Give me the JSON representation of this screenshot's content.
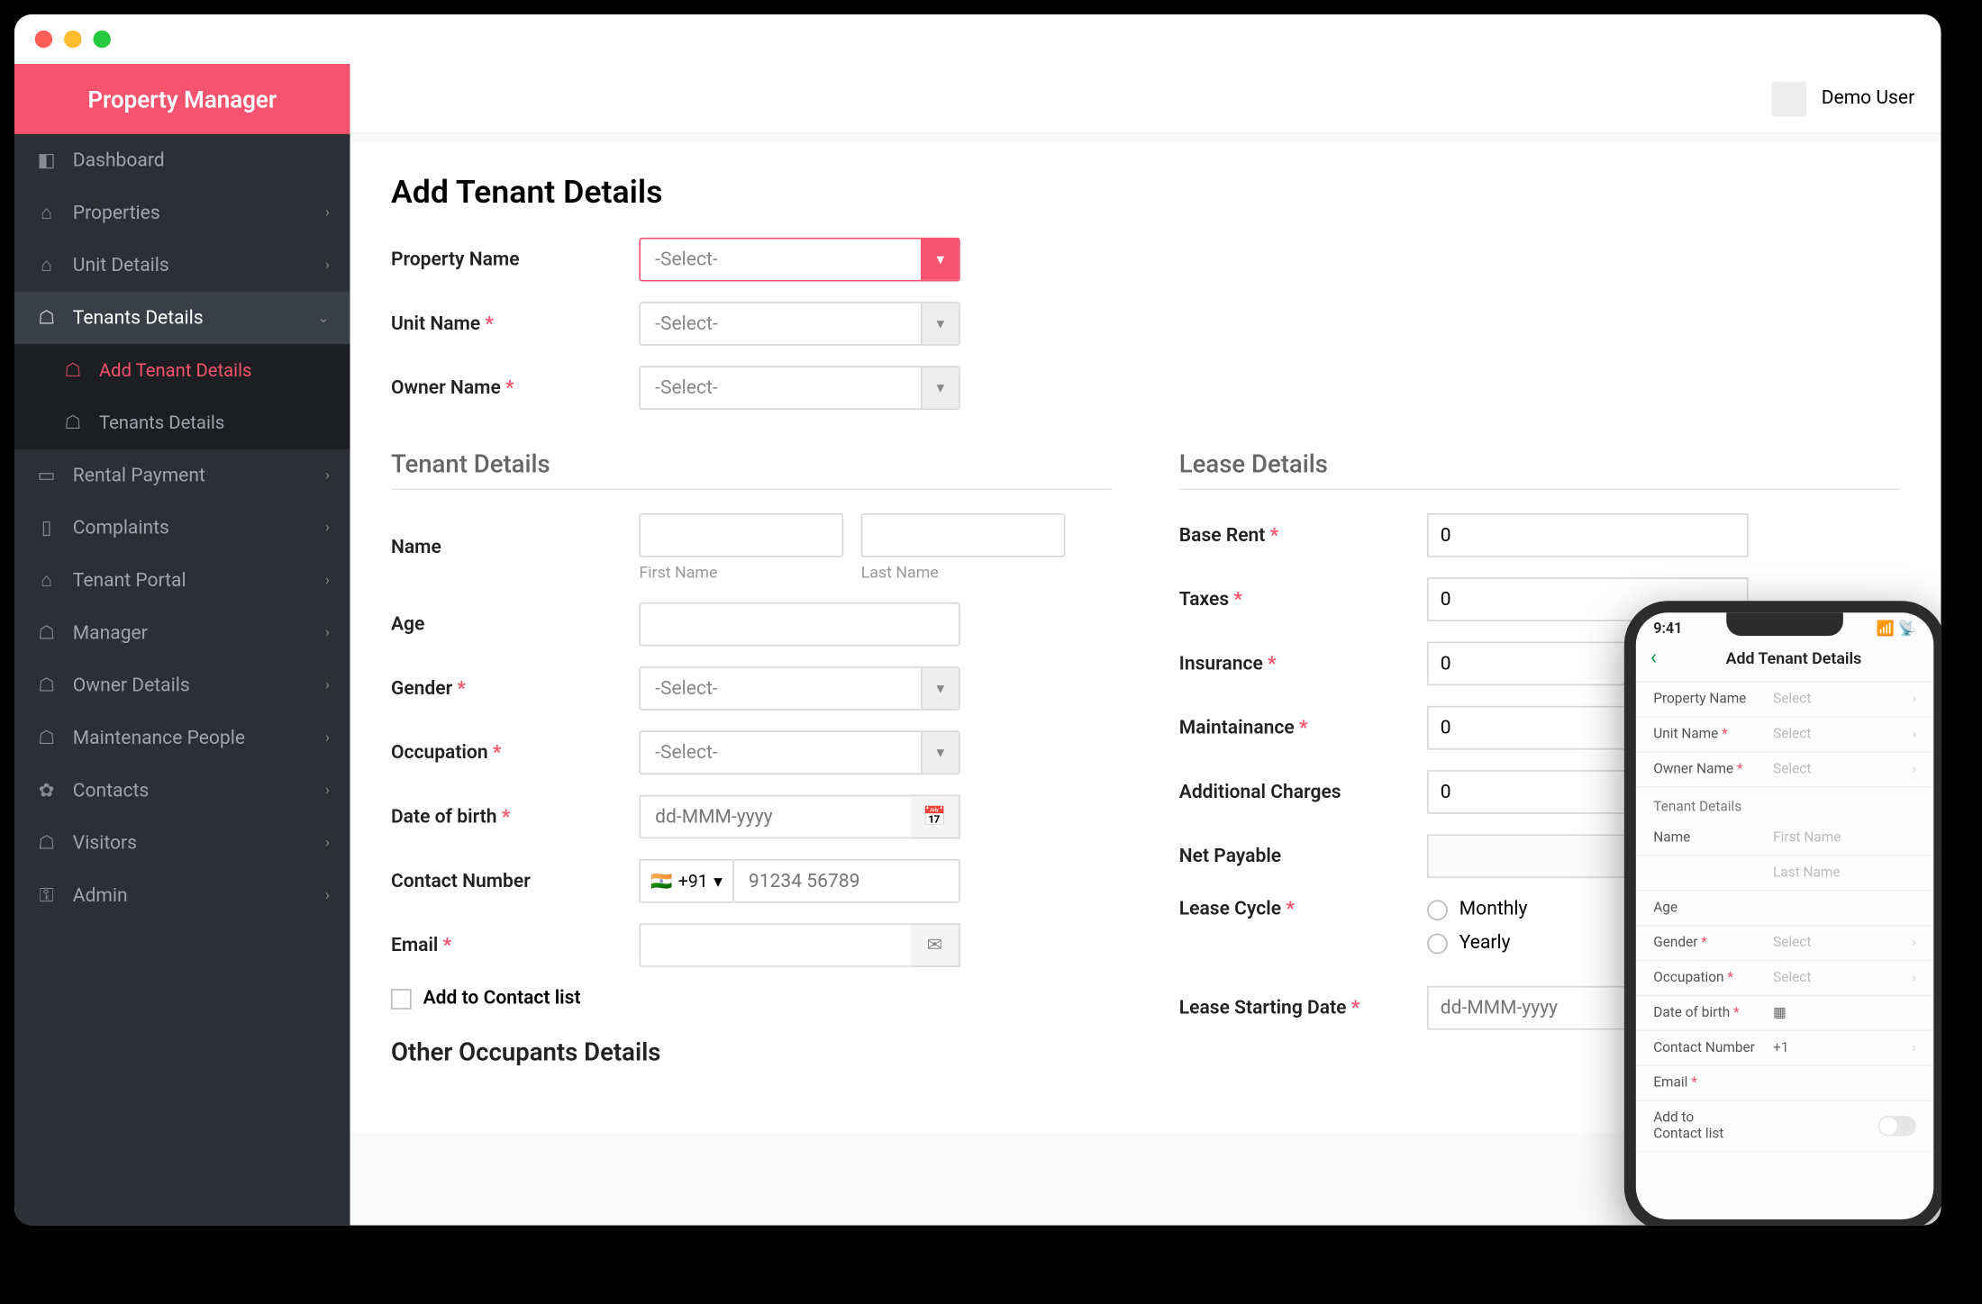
{
  "brand": "Property Manager",
  "user_name": "Demo User",
  "sidebar": {
    "items": [
      {
        "label": "Dashboard",
        "icon": "⌂",
        "chev": false
      },
      {
        "label": "Properties",
        "icon": "🏢",
        "chev": true
      },
      {
        "label": "Unit Details",
        "icon": "⌂",
        "chev": true
      },
      {
        "label": "Tenants Details",
        "icon": "👤",
        "chev": true,
        "active": true
      },
      {
        "label": "Rental Payment",
        "icon": "💳",
        "chev": true
      },
      {
        "label": "Complaints",
        "icon": "🗂",
        "chev": true
      },
      {
        "label": "Tenant Portal",
        "icon": "⌂",
        "chev": true
      },
      {
        "label": "Manager",
        "icon": "🧍",
        "chev": true
      },
      {
        "label": "Owner Details",
        "icon": "👥",
        "chev": true
      },
      {
        "label": "Maintenance People",
        "icon": "🛠",
        "chev": true
      },
      {
        "label": "Contacts",
        "icon": "⚙",
        "chev": true
      },
      {
        "label": "Visitors",
        "icon": "🚶",
        "chev": true
      },
      {
        "label": "Admin",
        "icon": "🔒",
        "chev": true
      }
    ],
    "sub": [
      {
        "label": "Add Tenant Details",
        "sel": true
      },
      {
        "label": "Tenants Details",
        "sel": false
      }
    ]
  },
  "page_title": "Add Tenant Details",
  "form": {
    "property_name": {
      "label": "Property Name",
      "value": "-Select-"
    },
    "unit_name": {
      "label": "Unit Name",
      "value": "-Select-"
    },
    "owner_name": {
      "label": "Owner Name",
      "value": "-Select-"
    }
  },
  "tenant": {
    "section": "Tenant Details",
    "name_label": "Name",
    "first_name_hint": "First Name",
    "last_name_hint": "Last Name",
    "age_label": "Age",
    "gender_label": "Gender",
    "gender_value": "-Select-",
    "occupation_label": "Occupation",
    "occupation_value": "-Select-",
    "dob_label": "Date of birth",
    "dob_placeholder": "dd-MMM-yyyy",
    "contact_label": "Contact Number",
    "dial": "+91",
    "contact_placeholder": "91234 56789",
    "email_label": "Email",
    "add_contact": "Add to Contact list"
  },
  "lease": {
    "section": "Lease Details",
    "base_rent": {
      "label": "Base Rent",
      "value": "0"
    },
    "taxes": {
      "label": "Taxes",
      "value": "0"
    },
    "insurance": {
      "label": "Insurance",
      "value": "0"
    },
    "maintainance": {
      "label": "Maintainance",
      "value": "0"
    },
    "additional": {
      "label": "Additional Charges",
      "value": "0"
    },
    "net": {
      "label": "Net Payable",
      "value": ""
    },
    "cycle": {
      "label": "Lease Cycle",
      "opt1": "Monthly",
      "opt2": "Yearly"
    },
    "start": {
      "label": "Lease Starting Date",
      "placeholder": "dd-MMM-yyyy"
    }
  },
  "other_section": "Other Occupants Details",
  "mobile": {
    "time": "9:41",
    "title": "Add Tenant Details",
    "rows": {
      "property": "Property Name",
      "unit": "Unit Name",
      "owner": "Owner Name",
      "select": "Select",
      "tenant_sec": "Tenant Details",
      "name": "Name",
      "first": "First Name",
      "last": "Last Name",
      "age": "Age",
      "gender": "Gender",
      "occupation": "Occupation",
      "dob": "Date of birth",
      "contact": "Contact Number",
      "dial": "+1",
      "email": "Email",
      "add": "Add to Contact list"
    }
  }
}
